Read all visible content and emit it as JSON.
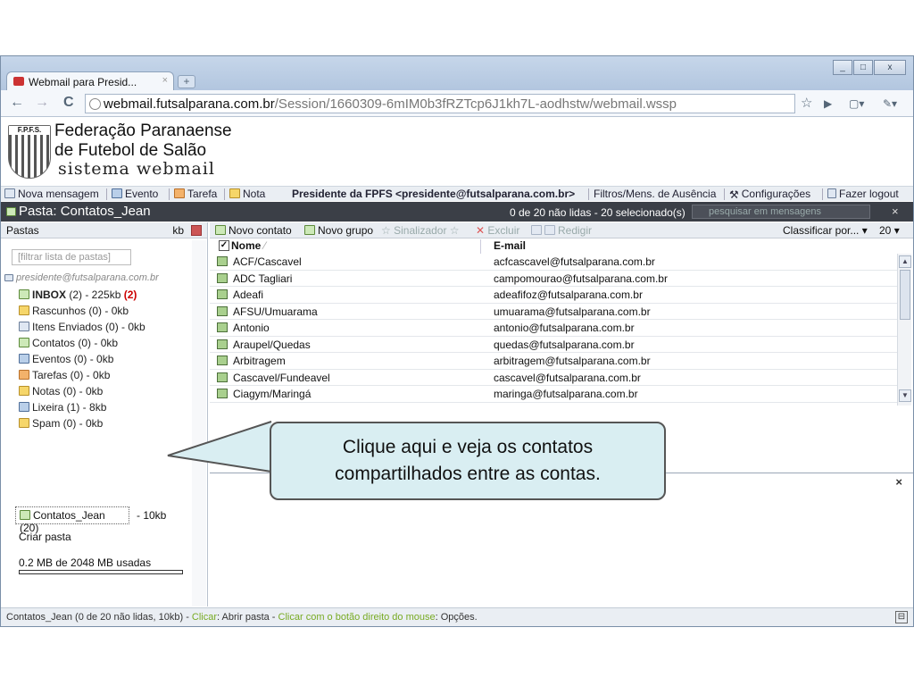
{
  "browser": {
    "tab_title": "Webmail para Presid...",
    "tab_close": "×",
    "new_tab": "+",
    "url_host": "webmail.futsalparana.com.br",
    "url_path": "/Session/1660309-6mIM0b3fRZTcp6J1kh7L-aodhstw/webmail.wssp",
    "win_min": "_",
    "win_max": "□",
    "win_close": "x",
    "back": "←",
    "forward": "→",
    "reload": "C",
    "star": "☆",
    "play": "▶",
    "page": "▢▾",
    "wrench": "✎▾"
  },
  "logo": {
    "badge": "F.P.F.S.",
    "line1": "Federação Paranaense",
    "line2": "de Futebol de Salão",
    "line3": "sistema webmail"
  },
  "toolbar": {
    "new_message": "Nova mensagem",
    "event": "Evento",
    "task": "Tarefa",
    "note": "Nota",
    "user": "Presidente da FPFS <presidente@futsalparana.com.br>",
    "filters": "Filtros/Mens. de Ausência",
    "settings": "Configurações",
    "logout": "Fazer logout"
  },
  "pathbar": {
    "title": "Pasta: Contatos_Jean",
    "counter": "0 de 20 não lidas - 20 selecionado(s)",
    "search_placeholder": "pesquisar em mensagens",
    "close": "×"
  },
  "sidebar": {
    "header": "Pastas",
    "kb_label": "kb",
    "filter_placeholder": "[filtrar lista de pastas]",
    "account": "presidente@futsalparana.com.br",
    "folders": [
      {
        "label": "INBOX",
        "rest": " (2)  - 225kb ",
        "unread": "(2)"
      },
      {
        "label": "Rascunhos (0)  - 0kb"
      },
      {
        "label": "Itens Enviados (0)  - 0kb"
      },
      {
        "label": "Contatos (0)  - 0kb"
      },
      {
        "label": "Eventos (0)  - 0kb"
      },
      {
        "label": "Tarefas (0)  - 0kb"
      },
      {
        "label": "Notas (0)  - 0kb"
      },
      {
        "label": "Lixeira (1)  - 8kb"
      },
      {
        "label": "Spam (0)  - 0kb"
      }
    ],
    "shared_folder": "Contatos_Jean (20)",
    "shared_size": "- 10kb",
    "create_folder": "Criar pasta",
    "usage": "0.2 MB de 2048 MB usadas"
  },
  "contacts_toolbar": {
    "new_contact": "Novo contato",
    "new_group": "Novo grupo",
    "flag": "Sinalizador",
    "delete": "Excluir",
    "compose": "Redigir",
    "sort": "Classificar por...",
    "page_size": "20"
  },
  "table": {
    "col_name": "Nome",
    "col_email": "E-mail",
    "rows": [
      {
        "name": "ACF/Cascavel",
        "email": "acfcascavel@futsalparana.com.br"
      },
      {
        "name": "ADC Tagliari",
        "email": "campomourao@futsalparana.com.br"
      },
      {
        "name": "Adeafi",
        "email": "adeafifoz@futsalparana.com.br"
      },
      {
        "name": "AFSU/Umuarama",
        "email": "umuarama@futsalparana.com.br"
      },
      {
        "name": "Antonio",
        "email": "antonio@futsalparana.com.br"
      },
      {
        "name": "Araupel/Quedas",
        "email": "quedas@futsalparana.com.br"
      },
      {
        "name": "Arbitragem",
        "email": "arbitragem@futsalparana.com.br"
      },
      {
        "name": "Cascavel/Fundeavel",
        "email": "cascavel@futsalparana.com.br"
      },
      {
        "name": "Ciagym/Maringá",
        "email": "maringa@futsalparana.com.br"
      }
    ]
  },
  "preview_close": "×",
  "status": {
    "part1": "Contatos_Jean (0 de 20 não lidas, 10kb) - ",
    "part2": "Clicar",
    "part3": ": Abrir pasta - ",
    "part4": "Clicar com o botão direito do mouse",
    "part5": ": Opções."
  },
  "callout": {
    "line1": "Clique aqui e veja os contatos",
    "line2": "compartilhados entre as contas."
  }
}
